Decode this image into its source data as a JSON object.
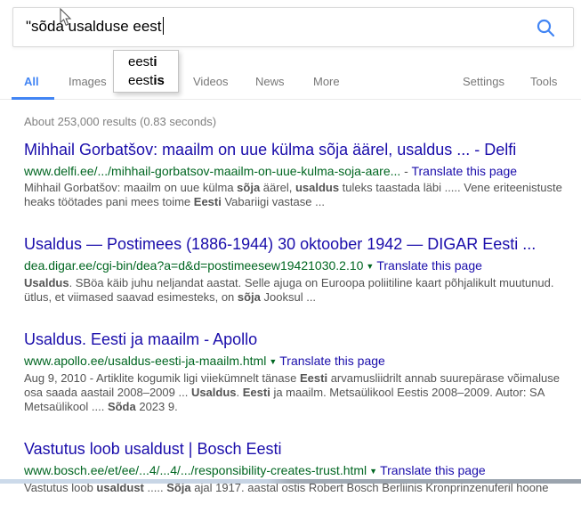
{
  "search": {
    "query": "\"sõda usalduse eest",
    "suggestions": [
      {
        "typed": "eest",
        "completion": "i"
      },
      {
        "typed": "eest",
        "completion": "is"
      }
    ]
  },
  "tabs": {
    "all": "All",
    "images": "Images",
    "videos": "Videos",
    "news": "News",
    "more": "More",
    "settings": "Settings",
    "tools": "Tools"
  },
  "stats": "About 253,000 results (0.83 seconds)",
  "colors": {
    "link_blue": "#1a0dab",
    "url_green": "#006621",
    "accent_blue": "#4285f4",
    "snippet_gray": "#545454"
  },
  "results": [
    {
      "title": "Mihhail Gorbatšov: maailm on uue külma sõja äärel, usaldus ... - Delfi",
      "url": "www.delfi.ee/.../mihhail-gorbatsov-maailm-on-uue-kulma-soja-aare...",
      "sep": "-",
      "translate": "Translate this page",
      "snippet": [
        {
          "t": "Mihhail Gorbatšov: maailm on uue külma "
        },
        {
          "t": "sõja",
          "b": true
        },
        {
          "t": " äärel, "
        },
        {
          "t": "usaldus",
          "b": true
        },
        {
          "t": " tuleks taastada läbi ..... Vene eriteenistuste heaks töötades pani mees toime "
        },
        {
          "t": "Eesti",
          "b": true
        },
        {
          "t": " Vabariigi vastase ..."
        }
      ]
    },
    {
      "title": "Usaldus — Postimees (1886-1944) 30 oktoober 1942 — DIGAR Eesti ...",
      "url": "dea.digar.ee/cgi-bin/dea?a=d&d=postimeesew19421030.2.10",
      "sep": "▼",
      "translate": "Translate this page",
      "snippet": [
        {
          "t": "Usaldus",
          "b": true
        },
        {
          "t": ". SBöa käib juhu neljandat aastat. Selle ajuga on Euroopa poliitiline kaart põhjalikult muutunud. ütlus, et viimased saavad esimesteks, on "
        },
        {
          "t": "sõja",
          "b": true
        },
        {
          "t": " Jooksul ..."
        }
      ]
    },
    {
      "title": "Usaldus. Eesti ja maailm - Apollo",
      "url": "www.apollo.ee/usaldus-eesti-ja-maailm.html",
      "sep": "▼",
      "translate": "Translate this page",
      "snippet": [
        {
          "t": "Aug 9, 2010 - Artiklite kogumik ligi viiekümnelt tänase "
        },
        {
          "t": "Eesti",
          "b": true
        },
        {
          "t": " arvamusliidrilt annab suurepärase võimaluse osa saada aastail 2008–2009 ... "
        },
        {
          "t": "Usaldus",
          "b": true
        },
        {
          "t": ". "
        },
        {
          "t": "Eesti",
          "b": true
        },
        {
          "t": " ja maailm. Metsaülikool Eestis 2008–2009. Autor: SA Metsaülikool .... "
        },
        {
          "t": "Sõda",
          "b": true
        },
        {
          "t": " 2023 9."
        }
      ]
    },
    {
      "title": "Vastutus loob usaldust | Bosch Eesti",
      "url": "www.bosch.ee/et/ee/...4/...4/.../responsibility-creates-trust.html",
      "sep": "▼",
      "translate": "Translate this page",
      "snippet": [
        {
          "t": "Vastutus loob "
        },
        {
          "t": "usaldust",
          "b": true
        },
        {
          "t": " ..... "
        },
        {
          "t": "Sõja",
          "b": true
        },
        {
          "t": " ajal 1917. aastal ostis Robert Bosch Berliinis Kronprinzenuferil hoone"
        }
      ]
    }
  ]
}
